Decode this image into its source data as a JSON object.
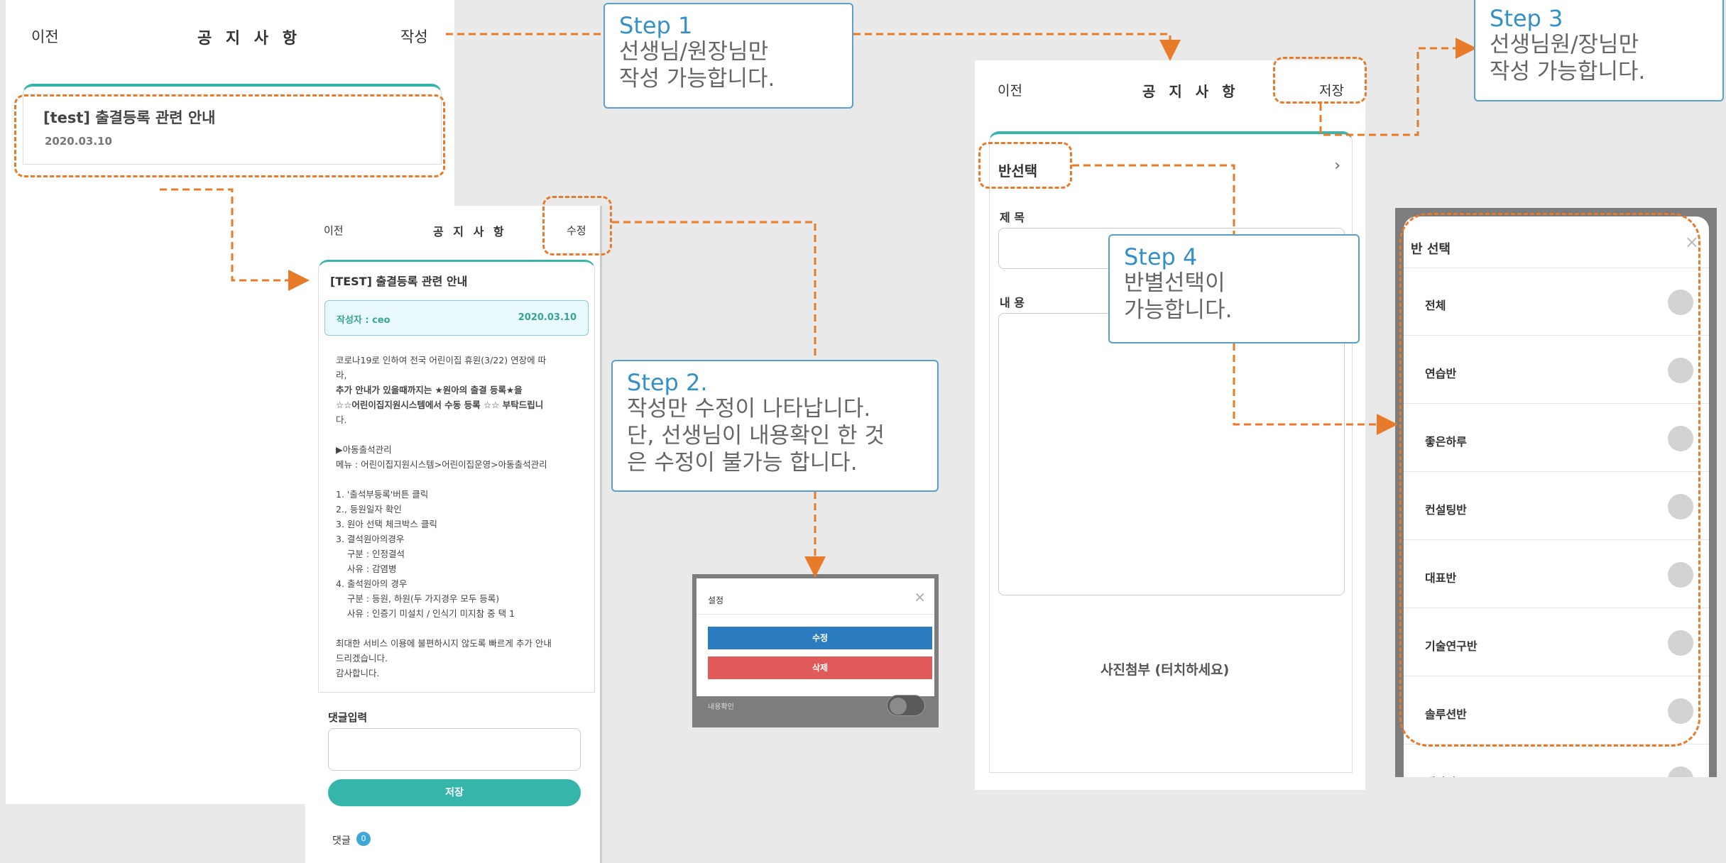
{
  "screen1": {
    "back": "이전",
    "title": "공 지 사 항",
    "write": "작성",
    "notice_title": "[test] 출결등록 관련 안내",
    "notice_date": "2020.03.10"
  },
  "screen2": {
    "back": "이전",
    "title": "공 지 사 항",
    "edit": "수정",
    "post_title": "[TEST] 출결등록 관련 안내",
    "author": "작성자 : ceo",
    "date": "2020.03.10",
    "content": [
      "코로나19로 인하여 전국 어린이집 휴원(3/22) 연장에 따",
      "라,",
      "추가 안내가 있을때까지는 ★원아의 출결 등록★을",
      "☆☆어린이집지원시스템에서 수동 등록 ☆☆ 부탁드립니",
      "다.",
      "",
      "▶아동출석관리",
      "메뉴 : 어린이집지원시스템>어린이집운영>아동출석관리",
      "",
      "1. '출석부등록'버튼 클릭",
      "2., 등원일자 확인",
      "3. 원아 선택 체크박스 클릭",
      "3. 결석원아의경우",
      "    구분 : 인정결석",
      "    사유 : 감염병",
      "4. 출석원아의 경우",
      "    구분 : 등원, 하원(두 가지경우 모두 등록)",
      "    사유 : 인증기 미설치 / 인식기 미지참 중 택 1",
      "",
      "최대한 서비스 이용에 불편하시지 않도록 빠르게 추가 안내",
      "드리겠습니다.",
      "감사합니다."
    ],
    "comment_label": "댓글입력",
    "save_button": "저장",
    "comments_label": "댓글",
    "comments_count": "0"
  },
  "settings": {
    "title": "설정",
    "edit_button": "수정",
    "delete_button": "삭제",
    "confirm_label": "내용확인"
  },
  "screen3": {
    "back": "이전",
    "title": "공 지 사 항",
    "save": "저장",
    "class_select": "반선택",
    "subject_label": "제 목",
    "content_label": "내 용",
    "photo_attach": "사진첨부 (터치하세요)"
  },
  "class_panel": {
    "title": "반 선택",
    "items": [
      "전체",
      "연습반",
      "좋은하루",
      "컨설팅반",
      "대표반",
      "기술연구반",
      "솔루션반",
      "개발반"
    ]
  },
  "steps": {
    "step1": {
      "title": "Step 1",
      "body": "선생님/원장님만\n작성 가능합니다."
    },
    "step2": {
      "title": "Step 2.",
      "body": "작성만 수정이 나타납니다.\n단, 선생님이 내용확인 한 것\n은 수정이 불가능 합니다."
    },
    "step3": {
      "title": "Step 3",
      "body": "선생님원/장님만\n작성 가능합니다."
    },
    "step4": {
      "title": "Step 4",
      "body": "반별선택이\n가능합니다."
    }
  },
  "colors": {
    "accent_teal": "#36b5ab",
    "callout_orange": "#e87b2a",
    "step_blue": "#3390c8",
    "edit_blue": "#2a7bbf",
    "delete_red": "#e05a5a"
  }
}
